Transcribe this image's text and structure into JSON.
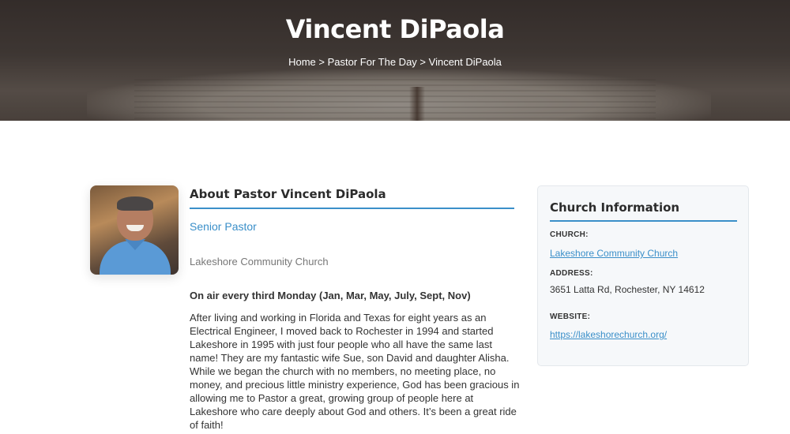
{
  "hero": {
    "title": "Vincent DiPaola",
    "breadcrumb": {
      "home": "Home",
      "sep1": " > ",
      "parent": "Pastor For The Day",
      "sep2": " > ",
      "current": "Vincent DiPaola"
    }
  },
  "profile": {
    "heading": "About Pastor Vincent DiPaola",
    "role": "Senior Pastor",
    "church": "Lakeshore Community Church",
    "on_air": "On air every third Monday (Jan, Mar, May, July, Sept, Nov)",
    "bio": "After living and working in Florida and Texas for eight years as an Electrical Engineer, I moved back to Rochester in 1994 and started Lakeshore in 1995 with just four people who all have the same last name! They are my fantastic wife Sue, son David and daughter Alisha. While we began the church with no members, no meeting place, no money, and precious little ministry experience, God has been gracious in allowing me to Pastor a great, growing group of people here at Lakeshore who care deeply about God and others. It’s been a great ride of faith!"
  },
  "church_info": {
    "title": "Church Information",
    "church_label": "CHURCH:",
    "church_value": "Lakeshore Community Church",
    "address_label": "ADDRESS:",
    "address_value": "3651 Latta Rd, Rochester, NY 14612",
    "website_label": "WEBSITE:",
    "website_value": "https://lakeshorechurch.org/"
  },
  "colors": {
    "accent": "#3a8fc9",
    "card_bg": "#f6f8fa"
  }
}
